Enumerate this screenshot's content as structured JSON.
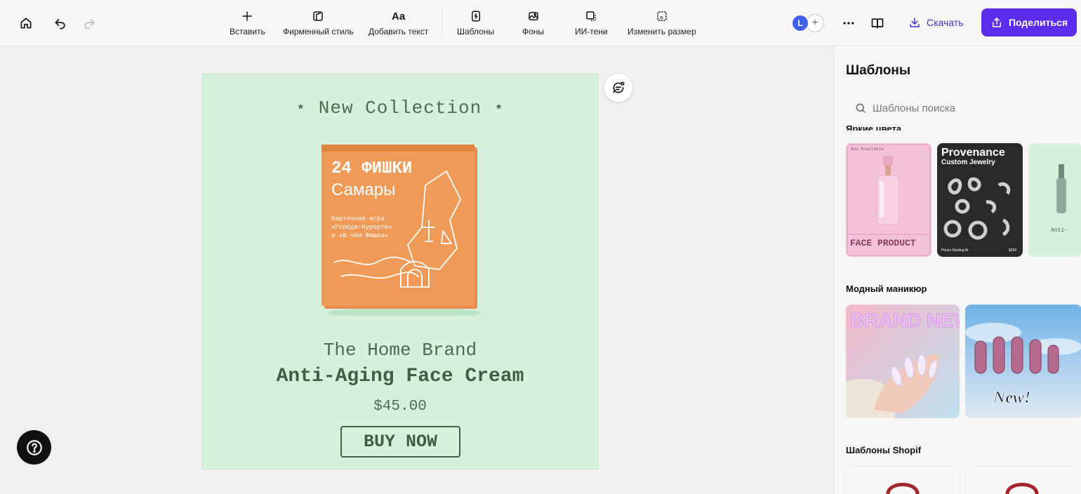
{
  "toolbar": {
    "tools": [
      {
        "label": "Вставить",
        "icon": "plus-icon"
      },
      {
        "label": "Фирменный стиль",
        "icon": "brand-kit-icon"
      },
      {
        "label": "Добавить текст",
        "icon": "text-icon"
      },
      {
        "label": "Шаблоны",
        "icon": "templates-icon"
      },
      {
        "label": "Фоны",
        "icon": "backgrounds-icon"
      },
      {
        "label": "ИИ-тени",
        "icon": "ai-shadow-icon"
      },
      {
        "label": "Изменить размер",
        "icon": "resize-icon"
      }
    ],
    "avatar_initial": "L",
    "download_label": "Скачать",
    "share_label": "Поделиться"
  },
  "design": {
    "background_color": "#d6f2dd",
    "headline": "⋆ New Collection ⋆",
    "brand": "The Home Brand",
    "product_name": "Anti-Aging Face Cream",
    "price": "$45.00",
    "cta": "BUY NOW",
    "box_line1": "24 ФИШКИ",
    "box_line2": "Самары",
    "box_desc1": "Карточная игра",
    "box_desc2": "«Города-Курорта»",
    "box_desc3": "и «В чём Фишка»"
  },
  "panel": {
    "title": "Шаблоны",
    "search_placeholder": "Шаблоны поиска",
    "sections": [
      {
        "label": "Яркие цвета"
      },
      {
        "label": "Модный маникюр"
      },
      {
        "label": "Шаблоны Shopif"
      }
    ],
    "thumbs": {
      "t1_top": "Now Available",
      "t1_bottom": "FACE PRODUCT",
      "t2_title": "Provenance",
      "t2_sub": "Custom Jewelry",
      "t2_foot_left": "Prices Starting At",
      "t2_foot_right": "$250",
      "t3_text": "Anti-",
      "t4_text": "BRAND NEW",
      "t5_text": "New!"
    }
  },
  "colors": {
    "accent": "#5b2dea",
    "download": "#4a2dd8",
    "box": "#ef9a56"
  }
}
